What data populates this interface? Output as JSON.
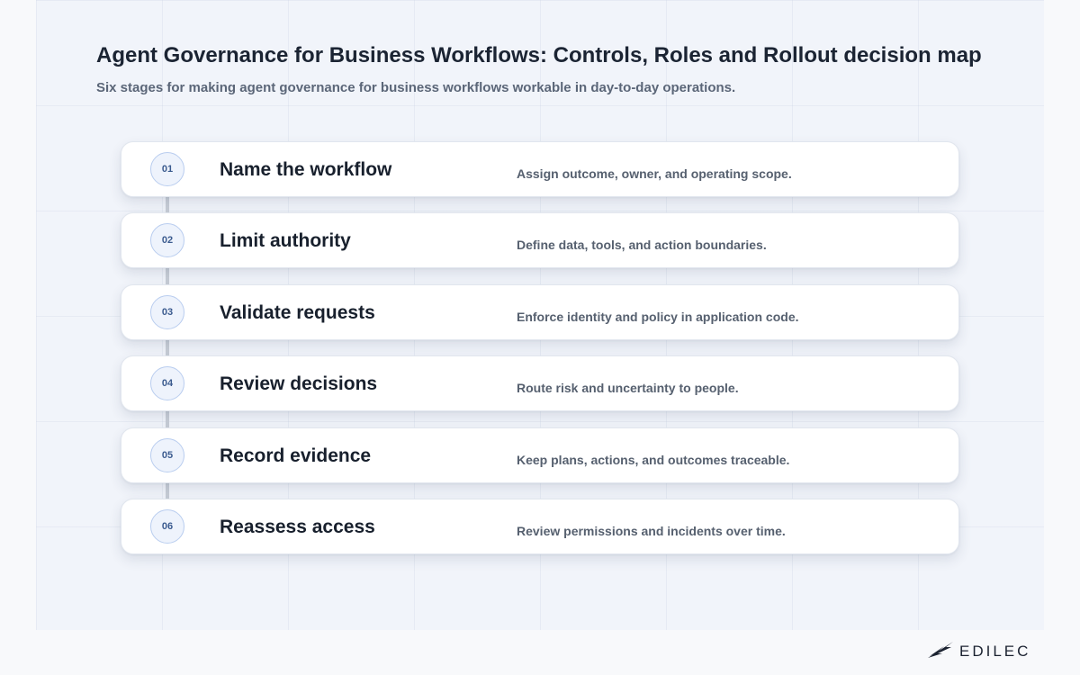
{
  "header": {
    "title": "Agent Governance for Business Workflows: Controls, Roles and Rollout decision map",
    "subtitle": "Six stages for making agent governance for business workflows workable in day-to-day operations."
  },
  "stages": [
    {
      "number": "01",
      "title": "Name the workflow",
      "description": "Assign outcome, owner, and operating scope."
    },
    {
      "number": "02",
      "title": "Limit authority",
      "description": "Define data, tools, and action boundaries."
    },
    {
      "number": "03",
      "title": "Validate requests",
      "description": "Enforce identity and policy in application code."
    },
    {
      "number": "04",
      "title": "Review decisions",
      "description": "Route risk and uncertainty to people."
    },
    {
      "number": "05",
      "title": "Record evidence",
      "description": "Keep plans, actions, and outcomes traceable."
    },
    {
      "number": "06",
      "title": "Reassess access",
      "description": "Review permissions and incidents over time."
    }
  ],
  "brand": {
    "logo_text": "EDILEC",
    "icon": "wing-logo-icon"
  },
  "colors": {
    "accent": "#3b5b8f",
    "badge_border": "#b9cdef",
    "connector": "#c7cdd6",
    "title_text": "#1b2433"
  }
}
